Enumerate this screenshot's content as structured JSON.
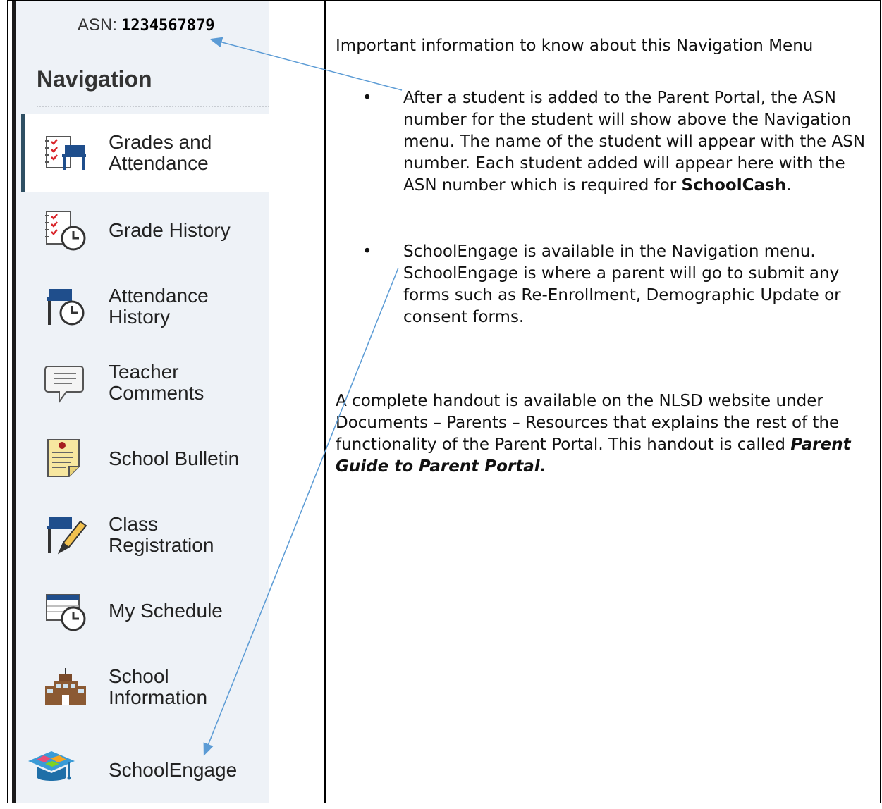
{
  "asn": {
    "label": "ASN:",
    "number": "1234567879"
  },
  "nav": {
    "title": "Navigation",
    "items": [
      {
        "label_line1": "Grades and",
        "label_line2": "Attendance",
        "icon": "grades-attendance-icon",
        "active": true
      },
      {
        "label_line1": "Grade History",
        "label_line2": "",
        "icon": "grade-history-icon"
      },
      {
        "label_line1": "Attendance",
        "label_line2": "History",
        "icon": "attendance-history-icon"
      },
      {
        "label_line1": "Teacher",
        "label_line2": "Comments",
        "icon": "comment-icon"
      },
      {
        "label_line1": "School Bulletin",
        "label_line2": "",
        "icon": "bulletin-icon"
      },
      {
        "label_line1": "Class",
        "label_line2": "Registration",
        "icon": "class-registration-icon"
      },
      {
        "label_line1": "My Schedule",
        "label_line2": "",
        "icon": "schedule-icon"
      },
      {
        "label_line1": "School",
        "label_line2": "Information",
        "icon": "school-building-icon"
      },
      {
        "label_line1": "SchoolEngage",
        "label_line2": "",
        "icon": "graduation-cap-icon"
      }
    ]
  },
  "doc": {
    "intro": "Important information to know about this Navigation Menu",
    "bullet1": {
      "text": "After a student is added to the Parent Portal, the ASN number for the student will show above the Navigation menu.   The name of the student will appear with the ASN number.   Each student added will appear here with the ASN number which is required for ",
      "bold": "SchoolCash",
      "end": "."
    },
    "bullet2": "SchoolEngage is available in the Navigation menu. SchoolEngage is where a parent will go to submit any forms such as Re-Enrollment, Demographic Update or consent forms.",
    "para": {
      "text": "A complete handout is available on the NLSD website under Documents – Parents – Resources that explains the rest of the functionality of the Parent Portal.  This handout is called ",
      "bold_italic": "Parent Guide to Parent Portal."
    },
    "bullet_char": "•"
  },
  "colors": {
    "nav_bg": "#eef2f7",
    "active_bar": "#2f4f63",
    "arrow": "#5b9bd5"
  }
}
